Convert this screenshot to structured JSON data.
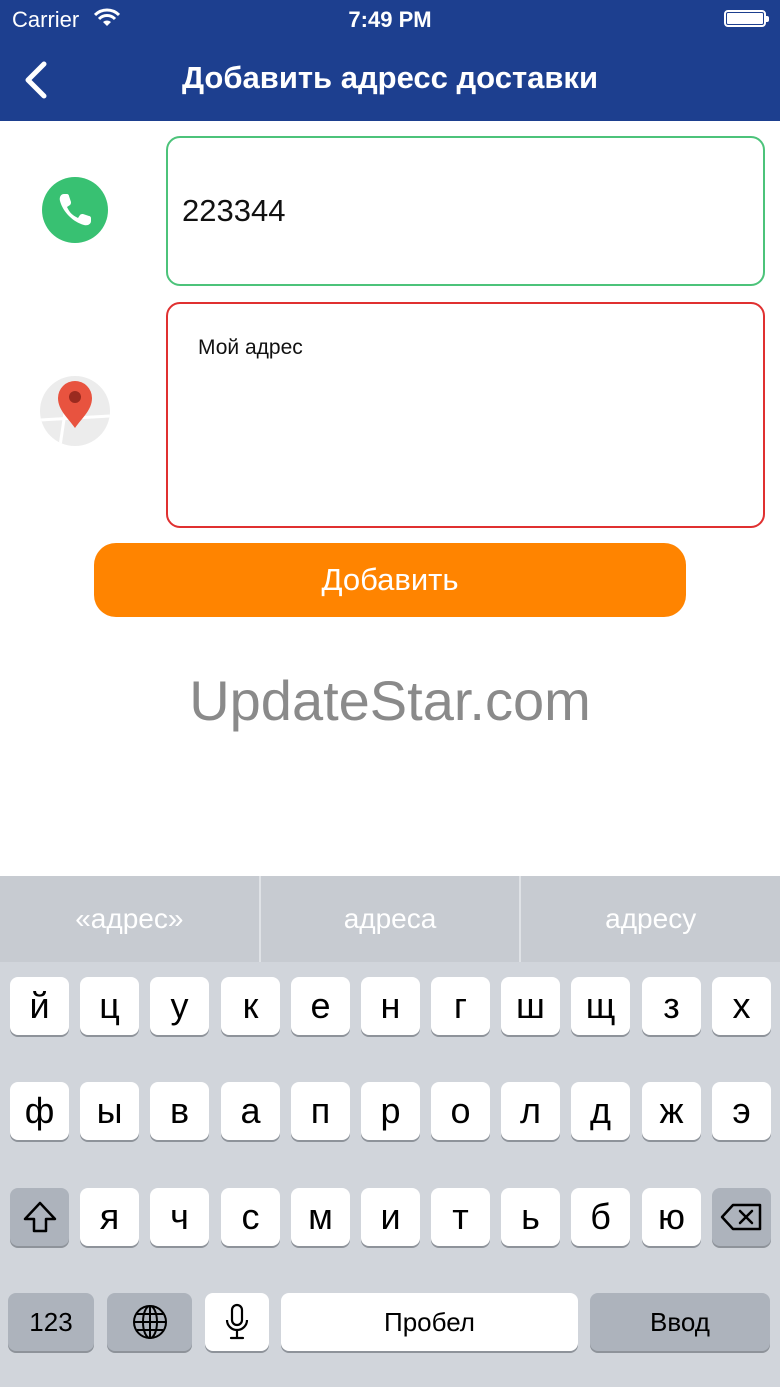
{
  "status_bar": {
    "carrier": "Carrier",
    "time": "7:49 PM"
  },
  "nav": {
    "title": "Добавить адресс доставки",
    "back_icon": "chevron-left-icon"
  },
  "form": {
    "phone_value": "223344",
    "address_value": "Мой адрес",
    "submit_label": "Добавить"
  },
  "watermark": "UpdateStar.com",
  "keyboard": {
    "suggestions": [
      "«адрес»",
      "адреса",
      "адресу"
    ],
    "row1": [
      "й",
      "ц",
      "у",
      "к",
      "е",
      "н",
      "г",
      "ш",
      "щ",
      "з",
      "х"
    ],
    "row2": [
      "ф",
      "ы",
      "в",
      "а",
      "п",
      "р",
      "о",
      "л",
      "д",
      "ж",
      "э"
    ],
    "row3": [
      "я",
      "ч",
      "с",
      "м",
      "и",
      "т",
      "ь",
      "б",
      "ю"
    ],
    "numbers_label": "123",
    "space_label": "Пробел",
    "return_label": "Ввод"
  },
  "colors": {
    "nav_bg": "#1d3f8f",
    "accent_orange": "#ff8400",
    "valid_border": "#4cc37a",
    "invalid_border": "#e03030"
  }
}
